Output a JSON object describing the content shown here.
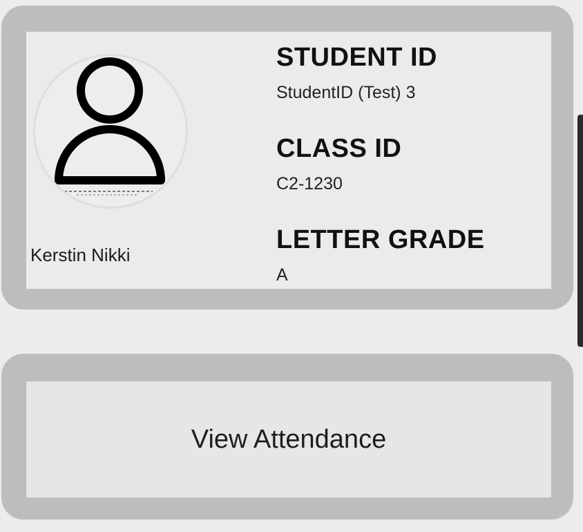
{
  "student_card": {
    "name": "Kerstin Nikki",
    "avatar_icon": "person-placeholder-icon",
    "fields": [
      {
        "label": "STUDENT ID",
        "value": "StudentID (Test) 3"
      },
      {
        "label": "CLASS ID",
        "value": "C2-1230"
      },
      {
        "label": "LETTER GRADE",
        "value": "A"
      }
    ]
  },
  "actions": {
    "view_attendance_label": "View Attendance"
  },
  "colors": {
    "background": "#ececec",
    "card_border": "#bdbdbd",
    "card_fill": "#ebebeb",
    "text": "#111111"
  }
}
